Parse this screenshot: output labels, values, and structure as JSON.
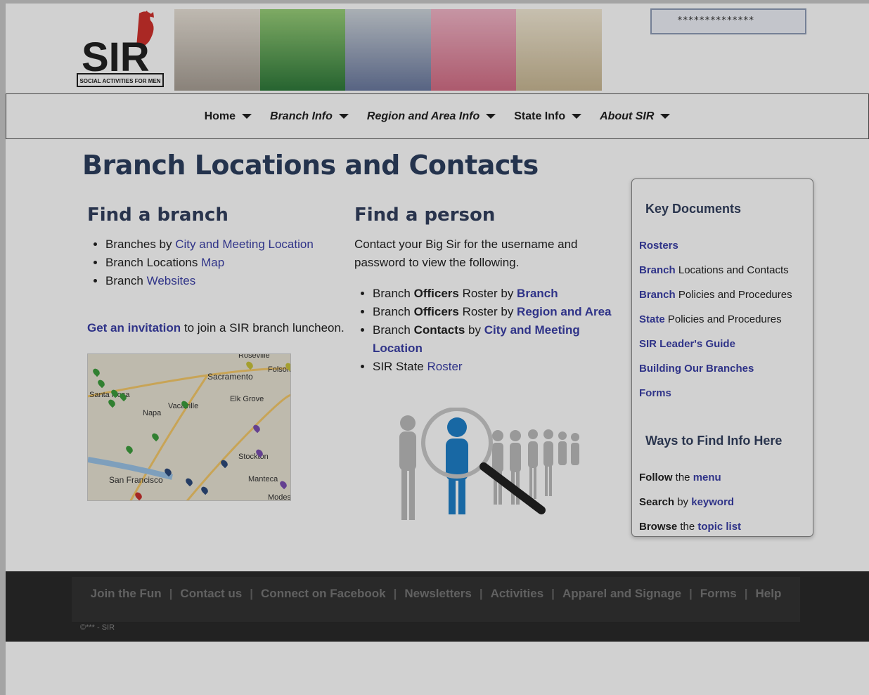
{
  "header": {
    "logo_text": "SIR",
    "logo_subtext": "SOCIAL ACTIVITIES FOR MEN",
    "password_field_value": "**************"
  },
  "nav": {
    "items": [
      {
        "label": "Home"
      },
      {
        "label": "Branch Info"
      },
      {
        "label": "Region and Area Info"
      },
      {
        "label": "State Info"
      },
      {
        "label": "About SIR"
      }
    ]
  },
  "page_title": "Branch Locations and Contacts",
  "find_branch": {
    "heading": "Find a branch",
    "items": [
      {
        "prefix": "Branches by ",
        "link": "City and Meeting Location"
      },
      {
        "prefix": "Branch Locations ",
        "link": "Map"
      },
      {
        "prefix": "Branch ",
        "link": "Websites"
      }
    ],
    "invite_link": "Get an invitation",
    "invite_text": " to join a SIR branch luncheon."
  },
  "map": {
    "labels": [
      "Roseville",
      "Folsom",
      "Sacramento",
      "Santa Rosa",
      "Vacaville",
      "Napa",
      "Elk Grove",
      "Stockton",
      "San Francisco",
      "Manteca",
      "Modesto"
    ]
  },
  "find_person": {
    "heading": "Find a person",
    "intro": "Contact your Big Sir for the username and password to view the following.",
    "items": [
      {
        "a": "Branch ",
        "b": "Officers",
        "c": " Roster by ",
        "link": "Branch"
      },
      {
        "a": "Branch ",
        "b": "Officers",
        "c": " Roster by ",
        "link": "Region and Area"
      },
      {
        "a": "Branch ",
        "b": "Contacts",
        "c": " by ",
        "link": "City and Meeting Location"
      },
      {
        "a": "SIR State ",
        "b": "",
        "c": "",
        "link": "Roster"
      }
    ]
  },
  "sidebar": {
    "key_docs_heading": "Key Documents",
    "key_docs": [
      {
        "link": "Rosters",
        "rest": ""
      },
      {
        "link": "Branch",
        "rest": " Locations and Contacts"
      },
      {
        "link": "Branch",
        "rest": " Policies and Procedures"
      },
      {
        "link": "State",
        "rest": " Policies and Procedures"
      },
      {
        "link": "SIR Leader's Guide",
        "rest": ""
      },
      {
        "link": "Building Our Branches",
        "rest": ""
      },
      {
        "link": "Forms",
        "rest": ""
      }
    ],
    "ways_heading": "Ways to Find Info Here",
    "ways": [
      {
        "bold": "Follow",
        "mid": " the ",
        "link": "menu"
      },
      {
        "bold": "Search",
        "mid": " by ",
        "link": "keyword"
      },
      {
        "bold": "Browse",
        "mid": " the ",
        "link": "topic list"
      }
    ]
  },
  "footer": {
    "links": [
      "Join the Fun",
      "Contact us",
      "Connect on Facebook",
      "Newsletters",
      "Activities",
      "Apparel and Signage",
      "Forms",
      "Help"
    ],
    "copyright": "©*** - SIR"
  },
  "colors": {
    "link": "#3a3fa6",
    "heading": "#2d3f5f",
    "footer_bg": "#2a2a2a"
  }
}
